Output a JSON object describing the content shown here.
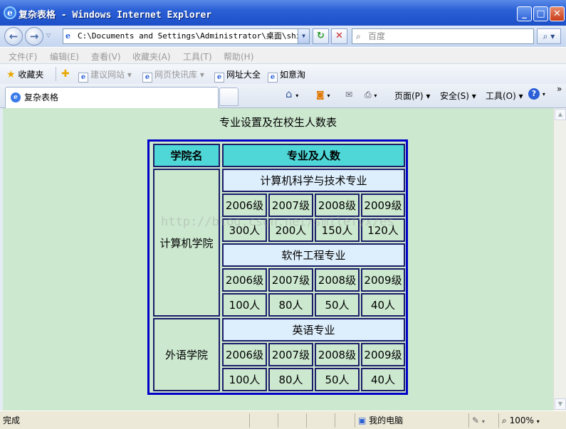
{
  "window": {
    "title": "复杂表格 - Windows Internet Explorer"
  },
  "address": {
    "url": "C:\\Documents and Settings\\Administrator\\桌面\\shiyan"
  },
  "search": {
    "placeholder": "百度"
  },
  "menu": [
    "文件(F)",
    "编辑(E)",
    "查看(V)",
    "收藏夹(A)",
    "工具(T)",
    "帮助(H)"
  ],
  "favorites": {
    "label": "收藏夹",
    "links": [
      "建议网站 ▾",
      "网页快讯库 ▾",
      "网址大全",
      "如意淘"
    ]
  },
  "tab": {
    "title": "复杂表格"
  },
  "commands": {
    "page": "页面(P) ▾",
    "safety": "安全(S) ▾",
    "tools": "工具(O) ▾",
    "help": "▾",
    "more": "»"
  },
  "page": {
    "caption": "专业设置及在校生人数表",
    "headers": {
      "college": "学院名",
      "majors": "专业及人数"
    },
    "colleges": [
      {
        "name": "计算机学院",
        "majors": [
          {
            "name": "计算机科学与技术专业",
            "grades": [
              "2006级",
              "2007级",
              "2008级",
              "2009级"
            ],
            "counts": [
              "300人",
              "200人",
              "150人",
              "120人"
            ]
          },
          {
            "name": "软件工程专业",
            "grades": [
              "2006级",
              "2007级",
              "2008级",
              "2009级"
            ],
            "counts": [
              "100人",
              "80人",
              "50人",
              "40人"
            ]
          }
        ]
      },
      {
        "name": "外语学院",
        "majors": [
          {
            "name": "英语专业",
            "grades": [
              "2006级",
              "2007级",
              "2008级",
              "2009级"
            ],
            "counts": [
              "100人",
              "80人",
              "50人",
              "40人"
            ]
          }
        ]
      }
    ],
    "watermark": "http://blog.csdn.net/smilefyx/es"
  },
  "status": {
    "text": "完成",
    "zone": "我的电脑",
    "zoom": "100%"
  }
}
